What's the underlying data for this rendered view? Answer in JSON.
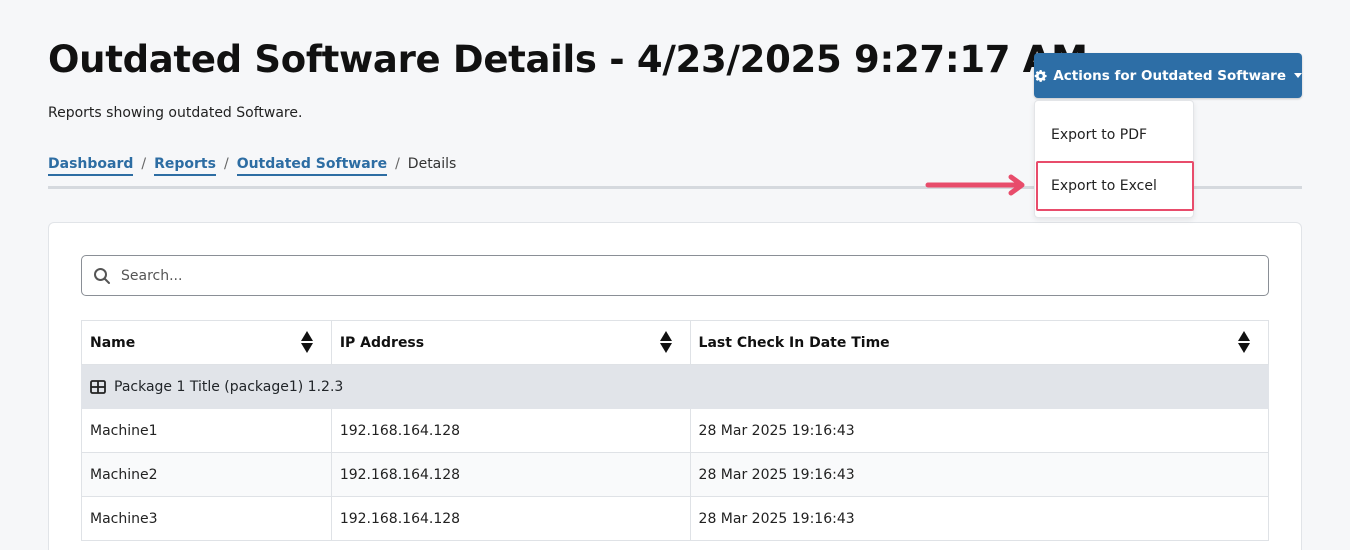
{
  "page": {
    "title": "Outdated Software Details - 4/23/2025 9:27:17 AM",
    "subtitle": "Reports showing outdated Software."
  },
  "breadcrumb": {
    "items": [
      "Dashboard",
      "Reports",
      "Outdated Software"
    ],
    "current": "Details",
    "separator": "/"
  },
  "actions": {
    "label": "Actions for Outdated Software",
    "icon": "gear-icon",
    "menu": [
      "Export to PDF",
      "Export to Excel"
    ],
    "highlighted": "Export to Excel"
  },
  "search": {
    "placeholder": "Search...",
    "value": ""
  },
  "table": {
    "columns": [
      "Name",
      "IP Address",
      "Last Check In Date Time"
    ],
    "group": "Package 1 Title (package1) 1.2.3",
    "rows": [
      [
        "Machine1",
        "192.168.164.128",
        "28 Mar 2025 19:16:43"
      ],
      [
        "Machine2",
        "192.168.164.128",
        "28 Mar 2025 19:16:43"
      ],
      [
        "Machine3",
        "192.168.164.128",
        "28 Mar 2025 19:16:43"
      ]
    ]
  },
  "colors": {
    "accent": "#2d6ea6",
    "highlight": "#e84c6b",
    "group_bg": "#e1e4e9"
  }
}
